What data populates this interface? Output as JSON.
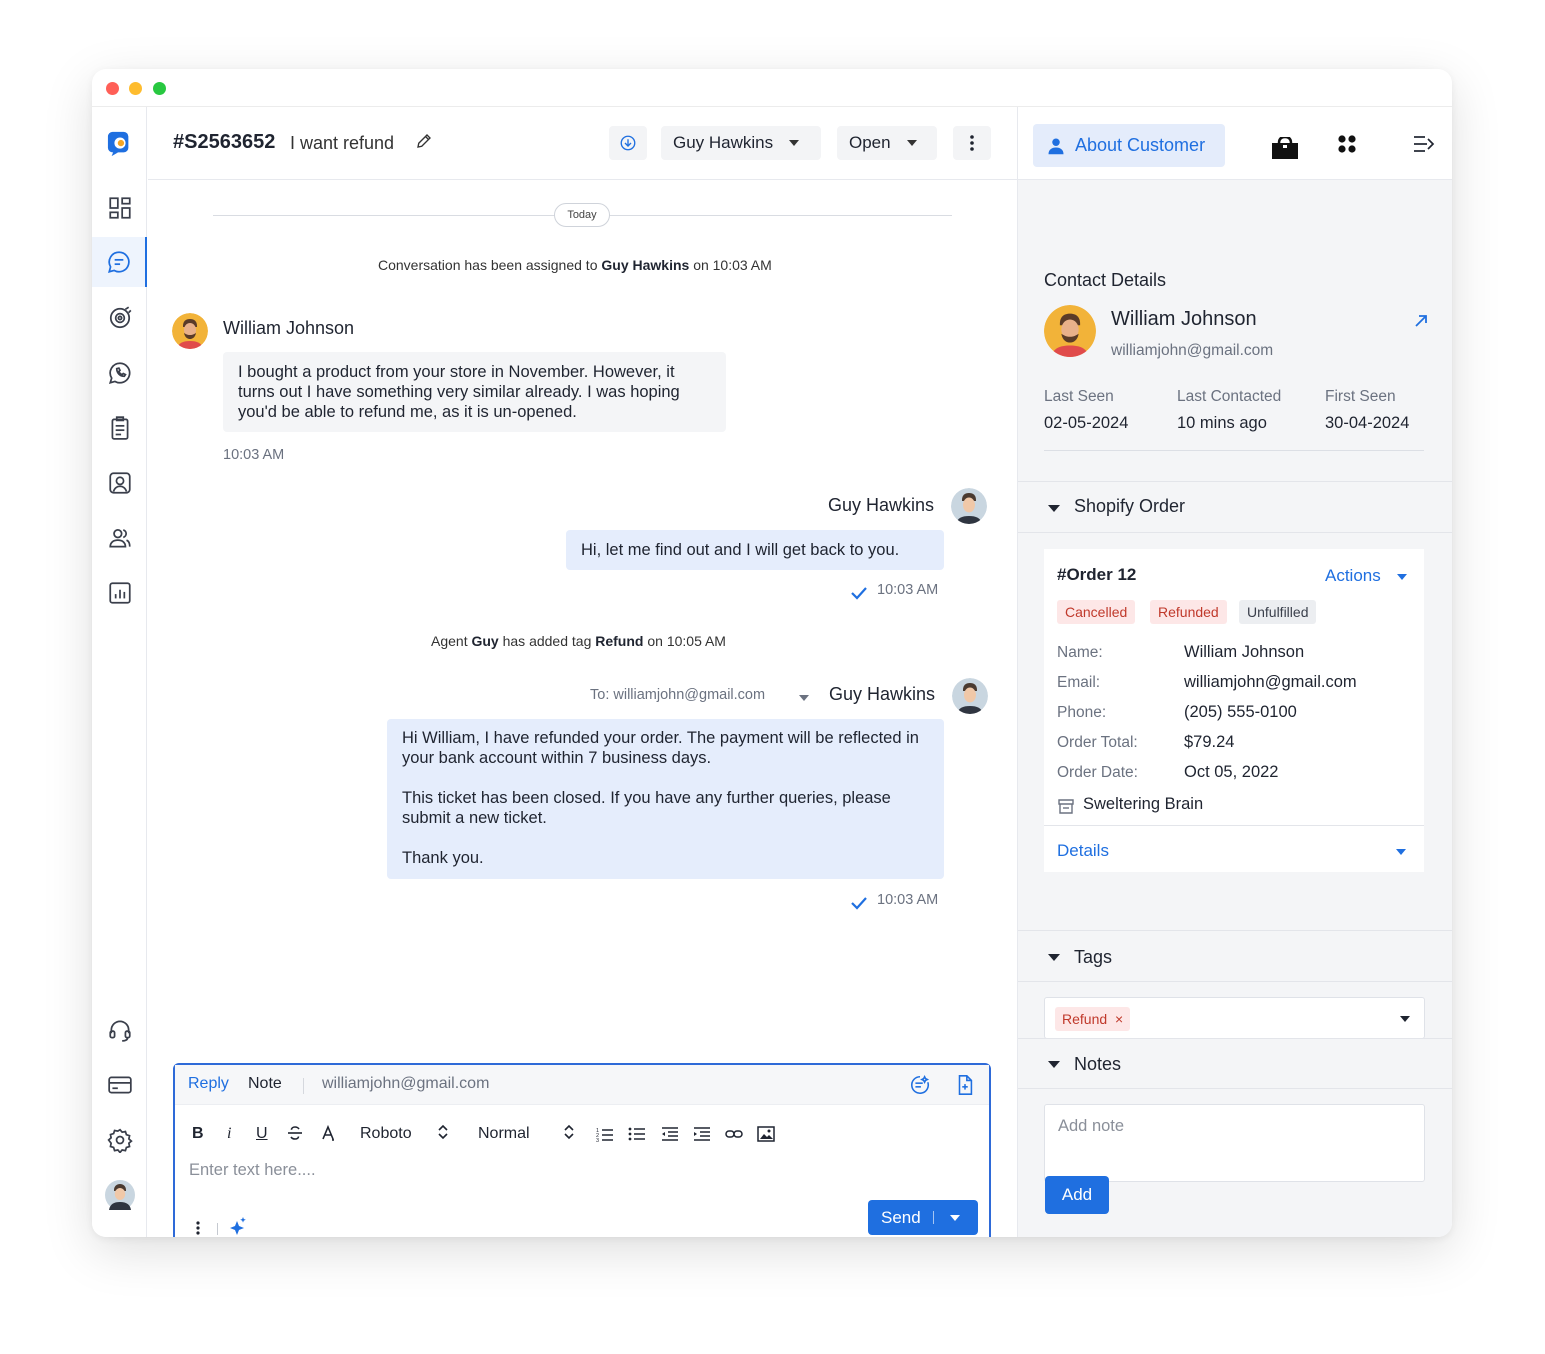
{
  "ticket": {
    "id": "#S2563652",
    "subject": "I want refund"
  },
  "header": {
    "assignee": "Guy Hawkins",
    "status": "Open"
  },
  "conversation": {
    "date_divider": "Today",
    "assigned_prefix": "Conversation has been assigned to",
    "assigned_agent": "Guy Hawkins",
    "assigned_suffix": "on 10:03  AM",
    "msg1": {
      "sender": "William Johnson",
      "text": "I bought a product from your store in November. However, it turns out I have something very similar already. I was hoping you'd be able to refund me, as it is un-opened.",
      "time": "10:03 AM"
    },
    "msg2": {
      "sender": "Guy Hawkins",
      "text": "Hi, let me find out and I will get back to you.",
      "time": "10:03 AM"
    },
    "tag_event": {
      "p1": "Agent",
      "agent": "Guy",
      "p2": "has added tag",
      "tag": "Refund",
      "p3": "on 10:05 AM"
    },
    "msg3": {
      "to": "To: williamjohn@gmail.com",
      "sender": "Guy Hawkins",
      "para1": "Hi William, I have refunded your order. The payment will be reflected in your bank account within 7 business days.",
      "para2": "This ticket has been closed. If you have any further queries, please submit a new ticket.",
      "para3": "Thank you.",
      "time": "10:03 AM"
    }
  },
  "composer": {
    "tab_reply": "Reply",
    "tab_note": "Note",
    "to_email": "williamjohn@gmail.com",
    "bold": "B",
    "italic": "i",
    "underline": "U",
    "font": "Roboto",
    "size": "Normal",
    "placeholder": "Enter text here....",
    "send": "Send"
  },
  "side": {
    "about_tab": "About Customer",
    "contact_title": "Contact Details",
    "customer_name": "William Johnson",
    "customer_email": "williamjohn@gmail.com",
    "last_seen_label": "Last Seen",
    "last_seen": "02-05-2024",
    "last_contacted_label": "Last Contacted",
    "last_contacted": "10 mins ago",
    "first_seen_label": "First Seen",
    "first_seen": "30-04-2024",
    "shopify_title": "Shopify Order",
    "order": {
      "title": "#Order 12",
      "actions": "Actions",
      "badges": [
        "Cancelled",
        "Refunded",
        "Unfulfilled"
      ],
      "rows": [
        {
          "label": "Name:",
          "value": "William Johnson"
        },
        {
          "label": "Email:",
          "value": "williamjohn@gmail.com"
        },
        {
          "label": "Phone:",
          "value": "(205) 555-0100"
        },
        {
          "label": "Order Total:",
          "value": "$79.24"
        },
        {
          "label": "Order Date:",
          "value": "Oct 05, 2022"
        }
      ],
      "store": "Sweltering Brain",
      "details": "Details"
    },
    "tags_title": "Tags",
    "tags": [
      "Refund"
    ],
    "notes_title": "Notes",
    "note_placeholder": "Add note",
    "add_button": "Add"
  },
  "colors": {
    "accent": "#1f6fe0",
    "outgoing_bubble": "#e5edfc",
    "cancelled_bg": "#fde7e7",
    "unfulfilled_bg": "#eceef1"
  }
}
